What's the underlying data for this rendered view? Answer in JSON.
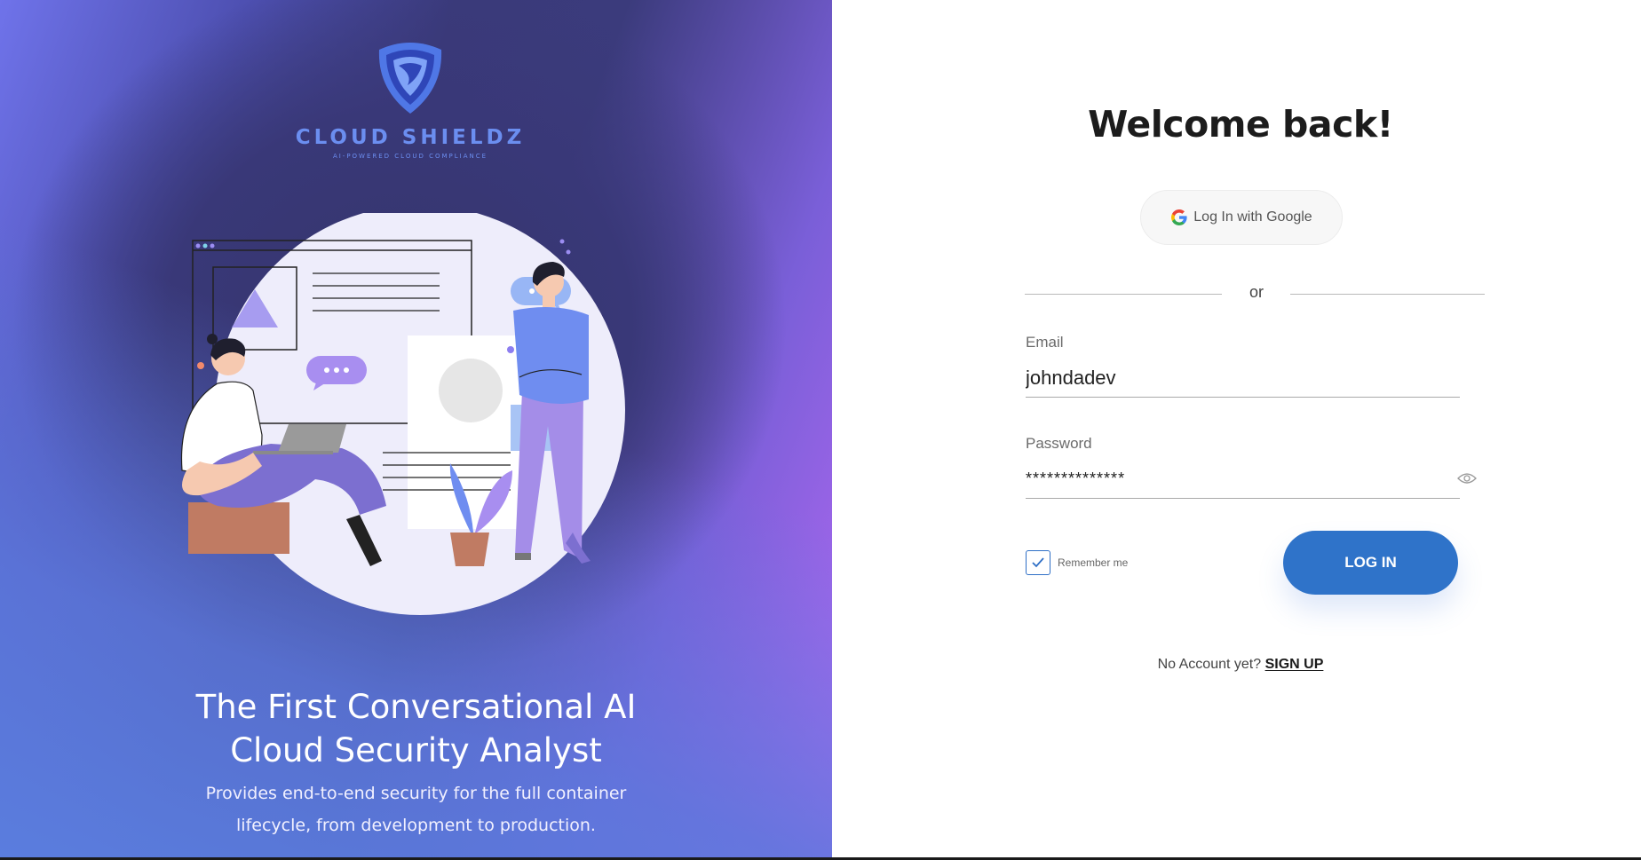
{
  "brand": {
    "name": "CLOUD SHIELDZ",
    "tagline": "AI-POWERED CLOUD COMPLIANCE"
  },
  "hero": {
    "headline_line1": "The First Conversational AI",
    "headline_line2": "Cloud Security Analyst",
    "subline_line1": "Provides end-to-end security for the full container",
    "subline_line2": "lifecycle, from development to production.",
    "code_badge": "</>"
  },
  "login": {
    "title": "Welcome back!",
    "google_button": "Log In with Google",
    "divider": "or",
    "email_label": "Email",
    "email_value": "johndadev",
    "password_label": "Password",
    "password_value": "**************",
    "remember_label": "Remember me",
    "remember_checked": true,
    "login_button": "LOG IN",
    "no_account_text": "No Account yet?",
    "signup_link": "SIGN UP"
  },
  "colors": {
    "accent": "#2f73c9",
    "brand_blue": "#6b8ef0",
    "panel_purple": "#3a3a7a"
  },
  "icons": [
    "shield-logo-icon",
    "google-icon",
    "eye-icon",
    "checkmark-icon"
  ]
}
